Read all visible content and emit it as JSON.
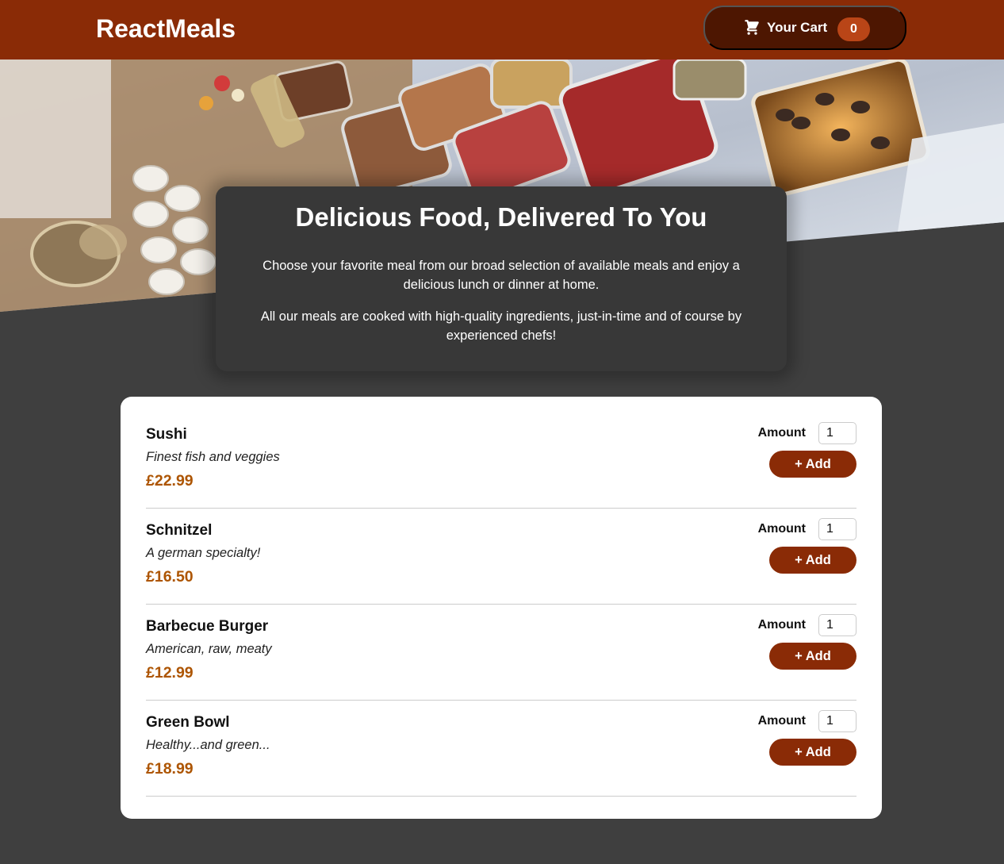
{
  "header": {
    "brand": "ReactMeals",
    "cart_label": "Your Cart",
    "cart_count": "0",
    "cart_icon": "shopping-cart-icon"
  },
  "colors": {
    "header_bg": "#8a2b06",
    "cart_button_bg": "#4d1601",
    "cart_badge_bg": "#b94517",
    "page_bg": "#3f3f3f",
    "summary_bg": "#383838",
    "price": "#ad5502",
    "add_button_bg": "#8a2b06"
  },
  "summary": {
    "title": "Delicious Food, Delivered To You",
    "paragraph_1": "Choose your favorite meal from our broad selection of available meals and enjoy a delicious lunch or dinner at home.",
    "paragraph_2": "All our meals are cooked with high-quality ingredients, just-in-time and of course by experienced chefs!"
  },
  "meals": [
    {
      "name": "Sushi",
      "description": "Finest fish and veggies",
      "price": "£22.99",
      "amount_label": "Amount",
      "amount_value": "1",
      "add_label": "+ Add"
    },
    {
      "name": "Schnitzel",
      "description": "A german specialty!",
      "price": "£16.50",
      "amount_label": "Amount",
      "amount_value": "1",
      "add_label": "+ Add"
    },
    {
      "name": "Barbecue Burger",
      "description": "American, raw, meaty",
      "price": "£12.99",
      "amount_label": "Amount",
      "amount_value": "1",
      "add_label": "+ Add"
    },
    {
      "name": "Green Bowl",
      "description": "Healthy...and green...",
      "price": "£18.99",
      "amount_label": "Amount",
      "amount_value": "1",
      "add_label": "+ Add"
    }
  ]
}
